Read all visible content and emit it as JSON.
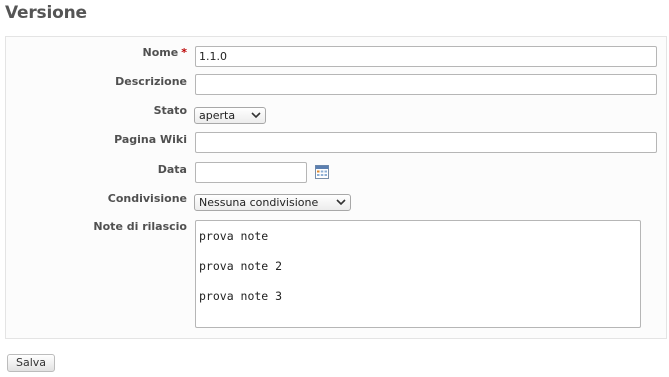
{
  "page": {
    "title": "Versione"
  },
  "form": {
    "name": {
      "label": "Nome",
      "required_mark": "*",
      "value": "1.1.0"
    },
    "description": {
      "label": "Descrizione",
      "value": ""
    },
    "status": {
      "label": "Stato",
      "selected": "aperta"
    },
    "wiki_page": {
      "label": "Pagina Wiki",
      "value": ""
    },
    "date": {
      "label": "Data",
      "value": ""
    },
    "sharing": {
      "label": "Condivisione",
      "selected": "Nessuna condivisione"
    },
    "release_notes": {
      "label": "Note di rilascio",
      "value": "prova note\nprova note 2\nprova note 3"
    }
  },
  "actions": {
    "save_label": "Salva"
  },
  "icons": {
    "calendar": "calendar-icon",
    "dropdown": "chevron-down-icon"
  }
}
